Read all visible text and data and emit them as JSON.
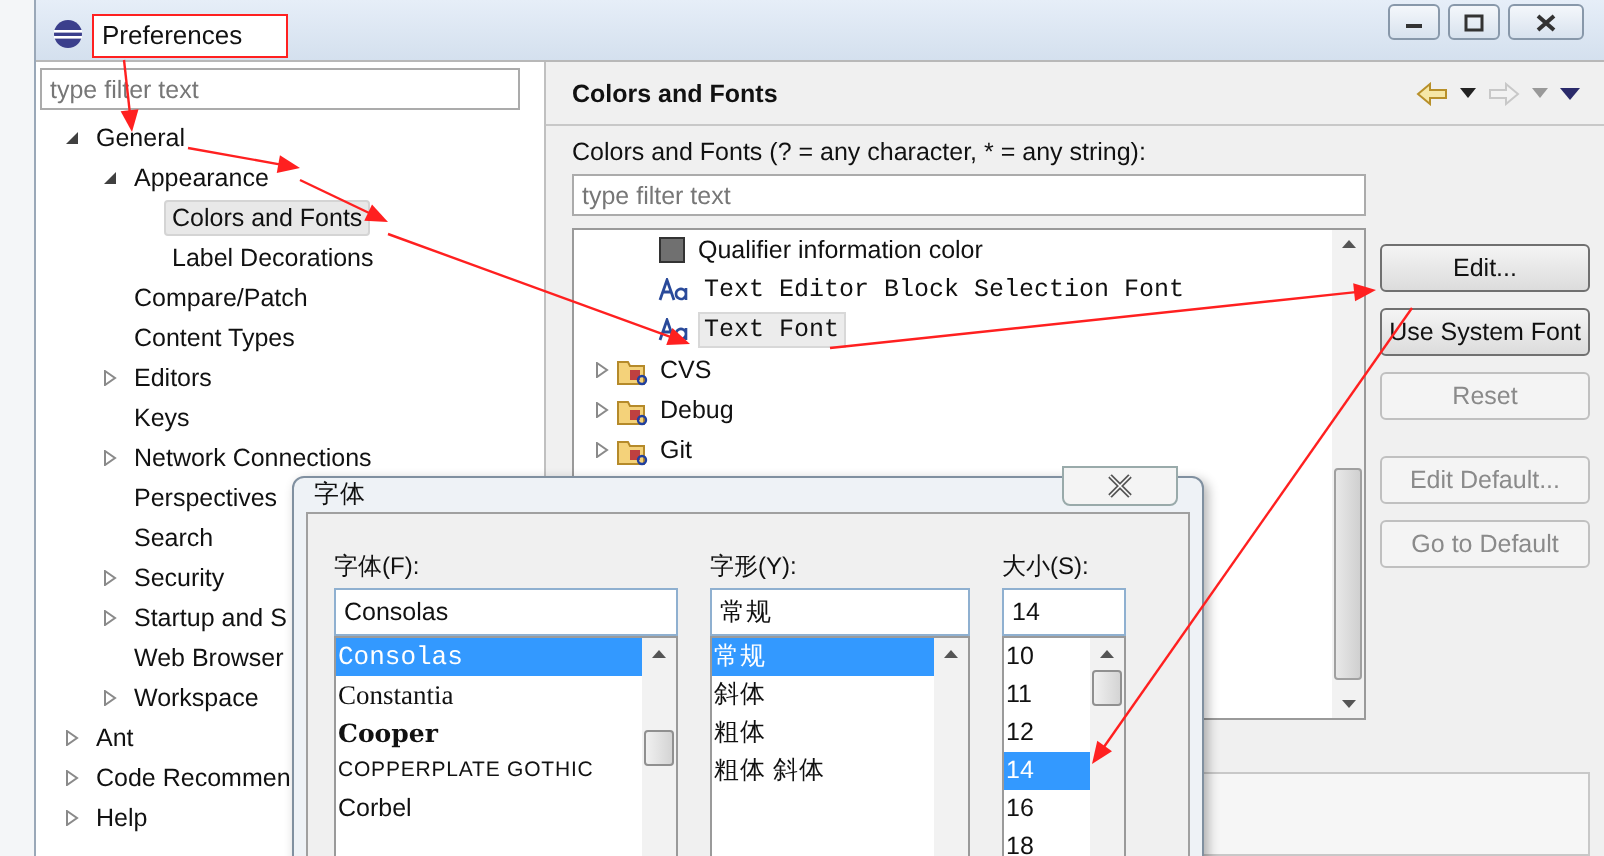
{
  "window": {
    "title": "Preferences"
  },
  "sidebar": {
    "filter_placeholder": "type filter text",
    "tree": [
      {
        "label": "General",
        "expanded": true,
        "selected": false,
        "children": [
          {
            "label": "Appearance",
            "expanded": true,
            "selected": false,
            "children": [
              {
                "label": "Colors and Fonts",
                "selected": true
              },
              {
                "label": "Label Decorations",
                "selected": false
              }
            ]
          },
          {
            "label": "Compare/Patch",
            "selected": false
          },
          {
            "label": "Content Types",
            "selected": false
          },
          {
            "label": "Editors",
            "expanded": false,
            "selected": false
          },
          {
            "label": "Keys",
            "selected": false
          },
          {
            "label": "Network Connections",
            "expanded": false,
            "selected": false
          },
          {
            "label": "Perspectives",
            "selected": false
          },
          {
            "label": "Search",
            "selected": false
          },
          {
            "label": "Security",
            "expanded": false,
            "selected": false
          },
          {
            "label": "Startup and S",
            "expanded": false,
            "selected": false
          },
          {
            "label": "Web Browser",
            "selected": false
          },
          {
            "label": "Workspace",
            "expanded": false,
            "selected": false
          }
        ]
      },
      {
        "label": "Ant",
        "expanded": false,
        "selected": false
      },
      {
        "label": "Code Recommen",
        "expanded": false,
        "selected": false
      },
      {
        "label": "Help",
        "expanded": false,
        "selected": false
      }
    ]
  },
  "page": {
    "title": "Colors and Fonts",
    "filter_label": "Colors and Fonts (? = any character, * = any string):",
    "filter_placeholder": "type filter text",
    "items": [
      {
        "kind": "color",
        "label": "Qualifier information color",
        "selected": false
      },
      {
        "kind": "font",
        "label": "Text Editor Block Selection Font",
        "selected": false
      },
      {
        "kind": "font",
        "label": "Text Font",
        "selected": true
      },
      {
        "kind": "category",
        "label": "CVS",
        "selected": false
      },
      {
        "kind": "category",
        "label": "Debug",
        "selected": false
      },
      {
        "kind": "category",
        "label": "Git",
        "selected": false
      }
    ],
    "buttons": [
      {
        "label": "Edit...",
        "disabled": false
      },
      {
        "label": "Use System Font",
        "disabled": false
      },
      {
        "label": "Reset",
        "disabled": true
      },
      {
        "label": "Edit Default...",
        "disabled": true
      },
      {
        "label": "Go to Default",
        "disabled": true
      }
    ]
  },
  "font_dialog": {
    "title": "字体",
    "columns": [
      {
        "label": "字体(F):",
        "value": "Consolas",
        "options": [
          {
            "label": "Consolas",
            "kind": "mono",
            "selected": true
          },
          {
            "label": "Constantia",
            "kind": "serif",
            "selected": false
          },
          {
            "label": "Cooper",
            "kind": "bold",
            "selected": false
          },
          {
            "label": "COPPERPLATE GOTHIC",
            "kind": "caps",
            "selected": false
          },
          {
            "label": "Corbel",
            "kind": "sans",
            "selected": false
          }
        ]
      },
      {
        "label": "字形(Y):",
        "value": "常规",
        "options": [
          {
            "label": "常规",
            "kind": "sans",
            "selected": true
          },
          {
            "label": "斜体",
            "kind": "sans",
            "selected": false
          },
          {
            "label": "粗体",
            "kind": "sans",
            "selected": false
          },
          {
            "label": "粗体 斜体",
            "kind": "sans",
            "selected": false
          }
        ]
      },
      {
        "label": "大小(S):",
        "value": "14",
        "options": [
          {
            "label": "10",
            "kind": "sans",
            "selected": false
          },
          {
            "label": "11",
            "kind": "sans",
            "selected": false
          },
          {
            "label": "12",
            "kind": "sans",
            "selected": false
          },
          {
            "label": "14",
            "kind": "sans",
            "selected": true
          },
          {
            "label": "16",
            "kind": "sans",
            "selected": false
          },
          {
            "label": "18",
            "kind": "sans",
            "selected": false
          }
        ]
      }
    ]
  }
}
